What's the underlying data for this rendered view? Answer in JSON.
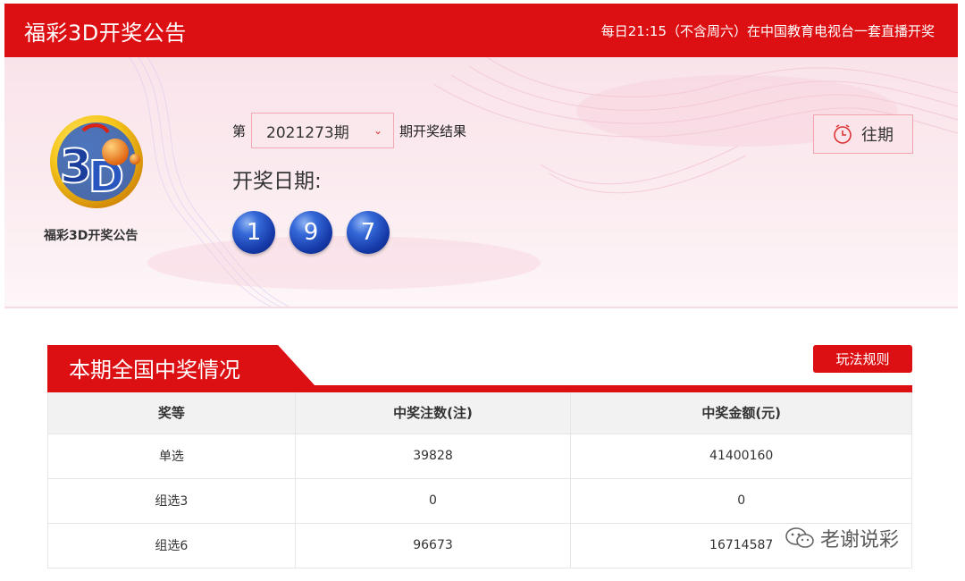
{
  "header": {
    "title": "福彩3D开奖公告",
    "schedule": "每日21:15（不含周六）在中国教育电视台一套直播开奖"
  },
  "logo": {
    "caption": "福彩3D开奖公告",
    "icon": "fucai-3d-logo"
  },
  "issue": {
    "prefix": "第",
    "selected": "2021273期",
    "suffix": "期开奖结果",
    "draw_date_label": "开奖日期:"
  },
  "balls": [
    "1",
    "9",
    "7"
  ],
  "history_button": {
    "label": "往期",
    "icon": "clock-icon"
  },
  "section": {
    "title": "本期全国中奖情况",
    "rules_button": "玩法规则"
  },
  "table": {
    "headers": [
      "奖等",
      "中奖注数(注)",
      "中奖金额(元)"
    ],
    "rows": [
      [
        "单选",
        "39828",
        "41400160"
      ],
      [
        "组选3",
        "0",
        "0"
      ],
      [
        "组选6",
        "96673",
        "16714587"
      ]
    ]
  },
  "watermark": {
    "text": "老谢说彩",
    "icon": "wechat-icon"
  },
  "colors": {
    "brand_red": "#dc0f12",
    "ball_blue": "#1a3fae"
  }
}
